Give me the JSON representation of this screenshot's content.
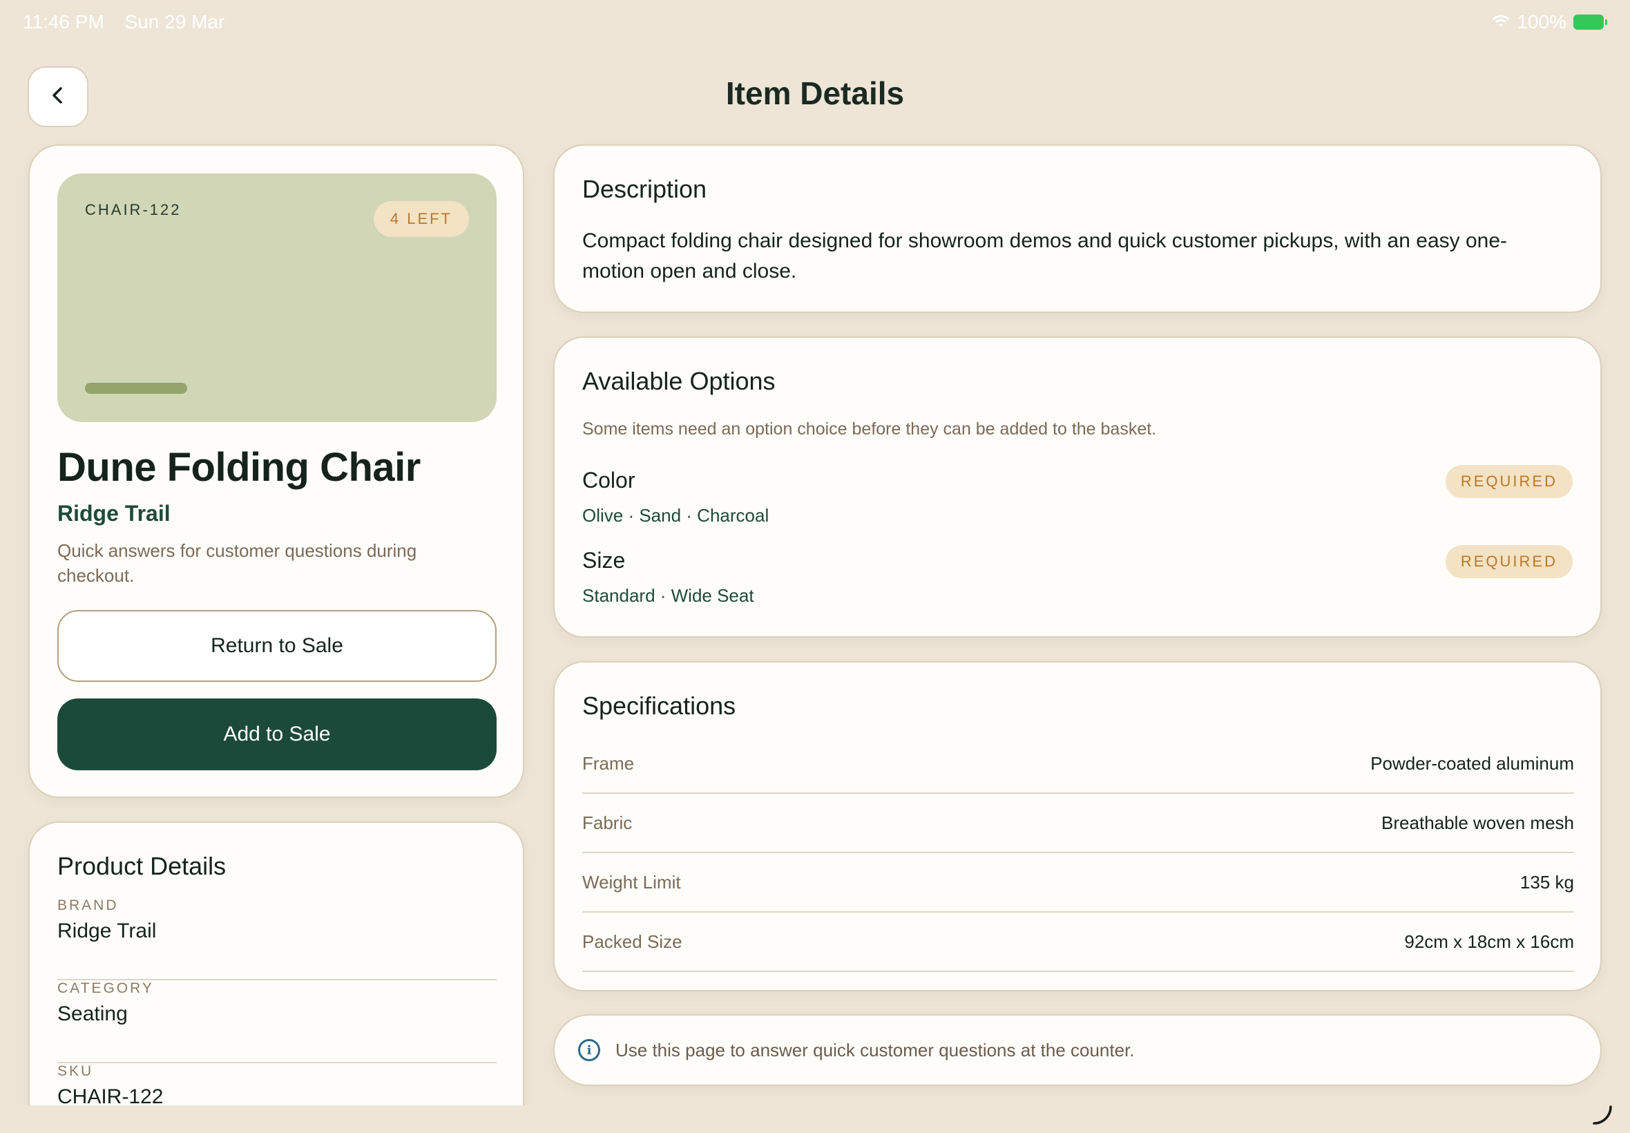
{
  "status_bar": {
    "time": "11:46 PM",
    "date": "Sun 29 Mar",
    "battery": "100%",
    "wifi_icon": "wifi-icon",
    "battery_icon": "battery-charging-icon"
  },
  "header": {
    "title": "Item Details",
    "back_icon": "chevron-left-icon"
  },
  "product": {
    "sku_tag": "CHAIR-122",
    "stock_badge": "4 LEFT",
    "name": "Dune Folding Chair",
    "brand": "Ridge Trail",
    "subtitle": "Quick answers for customer questions during checkout.",
    "return_label": "Return to Sale",
    "add_label": "Add to Sale"
  },
  "product_details": {
    "title": "Product Details",
    "rows": [
      {
        "label": "BRAND",
        "value": "Ridge Trail"
      },
      {
        "label": "CATEGORY",
        "value": "Seating"
      },
      {
        "label": "SKU",
        "value": "CHAIR-122"
      }
    ]
  },
  "description": {
    "title": "Description",
    "text": "Compact folding chair designed for showroom demos and quick customer pickups, with an easy one-motion open and close."
  },
  "options": {
    "title": "Available Options",
    "note": "Some items need an option choice before they can be added to the basket.",
    "items": [
      {
        "name": "Color",
        "values": "Olive · Sand · Charcoal",
        "badge": "REQUIRED"
      },
      {
        "name": "Size",
        "values": "Standard · Wide Seat",
        "badge": "REQUIRED"
      }
    ]
  },
  "specifications": {
    "title": "Specifications",
    "rows": [
      {
        "label": "Frame",
        "value": "Powder-coated aluminum"
      },
      {
        "label": "Fabric",
        "value": "Breathable woven mesh"
      },
      {
        "label": "Weight Limit",
        "value": "135 kg"
      },
      {
        "label": "Packed Size",
        "value": "92cm x 18cm x 16cm"
      }
    ]
  },
  "info": {
    "text": "Use this page to answer quick customer questions at the counter.",
    "icon": "info-icon"
  },
  "colors": {
    "background": "#EEE5D7",
    "card": "#FFFDFA",
    "primary": "#1C4A3A",
    "hero": "#D0D6B6",
    "badge_bg": "#F3E2C4",
    "badge_text": "#B9792A"
  }
}
